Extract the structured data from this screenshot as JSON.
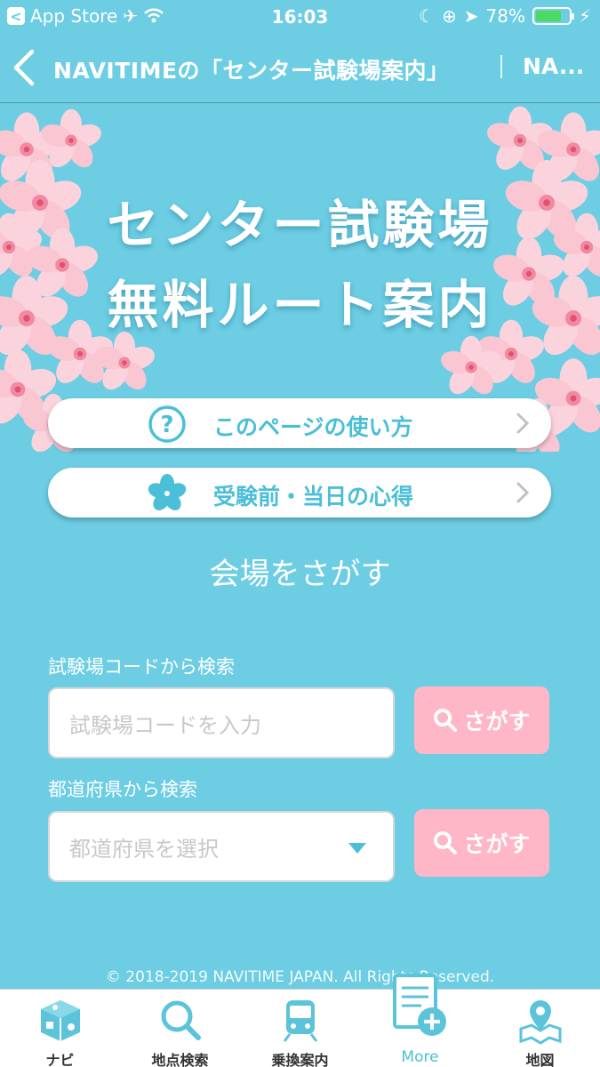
{
  "status_bar": {
    "back_app": "App Store",
    "time": "16:03",
    "battery": "78%",
    "battery_level": 0.78
  },
  "nav": {
    "title": "NAVITIMEの「センター試験場案内」",
    "title_secondary": "NA..."
  },
  "hero": {
    "title_line1": "センター試験場",
    "title_line2": "無料ルート案内"
  },
  "buttons": {
    "how_to_use": "このページの使い方",
    "tips": "受験前・当日の心得"
  },
  "search": {
    "heading": "会場をさがす",
    "code_label": "試験場コードから検索",
    "code_placeholder": "試験場コードを入力",
    "pref_label": "都道府県から検索",
    "pref_placeholder": "都道府県を選択",
    "search_button": "さがす"
  },
  "copyright": "© 2018-2019 NAVITIME JAPAN. All Rights Reserved.",
  "tabs": [
    {
      "label": "ナビ",
      "icon": "navi-cube-icon"
    },
    {
      "label": "地点検索",
      "icon": "magnifier-icon"
    },
    {
      "label": "乗換案内",
      "icon": "train-icon"
    },
    {
      "label": "More",
      "icon": "more-document-icon"
    },
    {
      "label": "地図",
      "icon": "map-pin-icon"
    }
  ],
  "colors": {
    "background": "#6ccde3",
    "accent": "#4bbfd7",
    "search_button": "#ffb6c6",
    "blossom": "#f9c6d2"
  }
}
